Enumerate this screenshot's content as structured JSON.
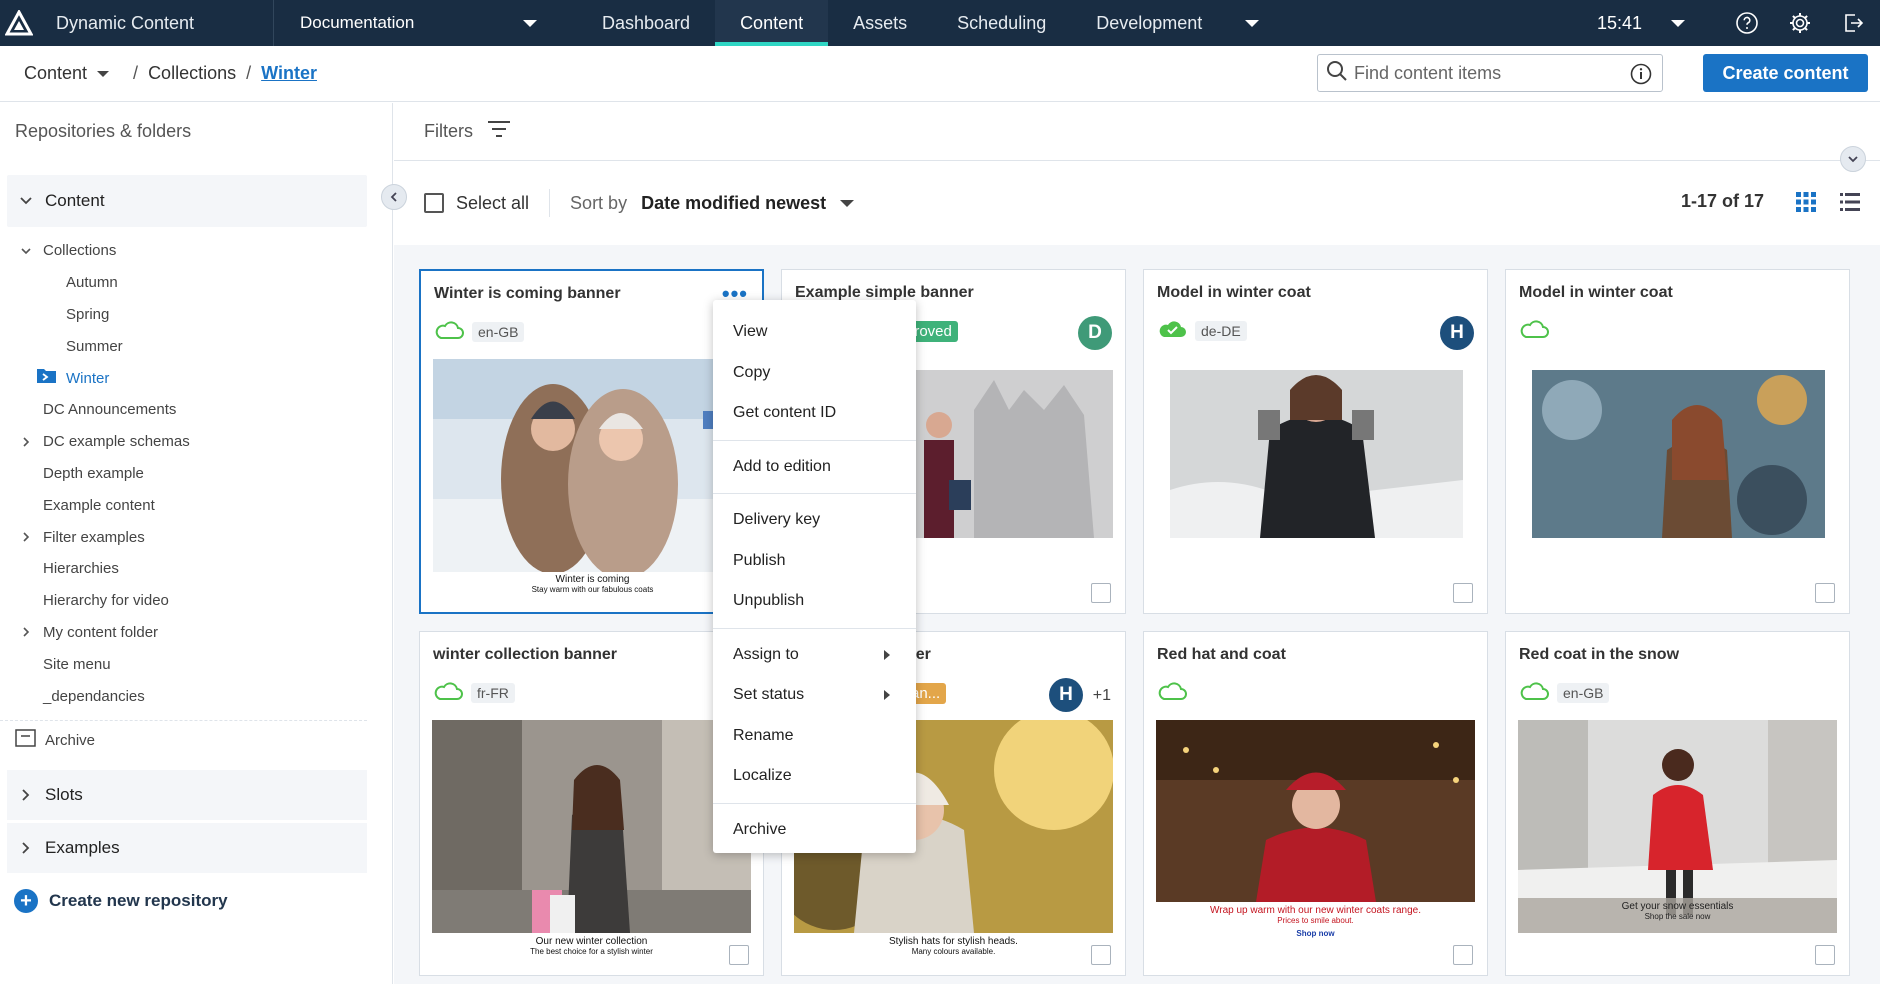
{
  "topbar": {
    "app_name": "Dynamic Content",
    "workspace": "Documentation",
    "tabs": [
      {
        "label": "Dashboard"
      },
      {
        "label": "Content"
      },
      {
        "label": "Assets"
      },
      {
        "label": "Scheduling"
      },
      {
        "label": "Development"
      }
    ],
    "active_tab": "Content",
    "time": "15:41"
  },
  "breadcrumb": {
    "root": "Content",
    "middle": "Collections",
    "current": "Winter",
    "sep": "/"
  },
  "search": {
    "placeholder": "Find content items"
  },
  "create_button": "Create content",
  "sidebar": {
    "title": "Repositories & folders",
    "content_group": "Content",
    "tree": {
      "collections": "Collections",
      "autumn": "Autumn",
      "spring": "Spring",
      "summer": "Summer",
      "winter": "Winter",
      "dc_announcements": "DC Announcements",
      "dc_example_schemas": "DC example schemas",
      "depth_example": "Depth example",
      "example_content": "Example content",
      "filter_examples": "Filter examples",
      "hierarchies": "Hierarchies",
      "hierarchy_for_video": "Hierarchy for video",
      "my_content_folder": "My content folder",
      "site_menu": "Site menu",
      "dependancies": "_dependancies",
      "archive": "Archive"
    },
    "slots": "Slots",
    "examples": "Examples",
    "create_repo": "Create new repository"
  },
  "filters_label": "Filters",
  "toolbar": {
    "select_all": "Select all",
    "sort_label": "Sort by",
    "sort_value": "Date modified newest",
    "count": "1-17 of 17"
  },
  "colors": {
    "topbar": "#192d43",
    "accent": "#1a73c5",
    "active_underline": "#2fd6c4",
    "cloud_green": "#4ec24a",
    "approved": "#3fb27a",
    "in_translation": "#e3a64a",
    "avatar_d": "#3f9a78",
    "avatar_h": "#1d4f7c"
  },
  "cards": [
    {
      "title": "Winter is coming banner",
      "locale": "en-GB",
      "cloud": "outline",
      "caption": "Winter is coming",
      "caption_sub": "Stay warm with our fabulous coats",
      "selected": true
    },
    {
      "title": "Example simple banner",
      "status": "Approved",
      "status_visible": "proved",
      "avatar": "D",
      "cloud": "outline"
    },
    {
      "title": "Model in winter coat",
      "locale": "de-DE",
      "cloud": "filled-check",
      "avatar": "H"
    },
    {
      "title": "Model in winter coat",
      "cloud": "outline"
    },
    {
      "title": "winter collection banner",
      "locale": "fr-FR",
      "cloud": "outline",
      "caption": "Our new winter collection",
      "caption_sub": "The best choice for a stylish winter"
    },
    {
      "title": "Stylish hats banner",
      "title_visible": "ner",
      "status_visible": "ran...",
      "avatar": "H",
      "avatar_extra": "+1",
      "caption": "Stylish hats for stylish heads.",
      "caption_sub": "Many colours available."
    },
    {
      "title": "Red hat and coat",
      "cloud": "outline",
      "caption": "Wrap up warm with our new winter coats range.",
      "caption_sub": "Prices to smile about.",
      "caption_link": "Shop now"
    },
    {
      "title": "Red coat in the snow",
      "locale": "en-GB",
      "cloud": "outline",
      "caption": "Get your snow essentials",
      "caption_sub": "Shop the sale now"
    }
  ],
  "context_menu": [
    {
      "label": "View"
    },
    {
      "label": "Copy"
    },
    {
      "label": "Get content ID"
    },
    {
      "label": "Add to edition"
    },
    {
      "label": "Delivery key"
    },
    {
      "label": "Publish"
    },
    {
      "label": "Unpublish"
    },
    {
      "label": "Assign to",
      "submenu": true
    },
    {
      "label": "Set status",
      "submenu": true
    },
    {
      "label": "Rename"
    },
    {
      "label": "Localize"
    },
    {
      "label": "Archive"
    }
  ]
}
